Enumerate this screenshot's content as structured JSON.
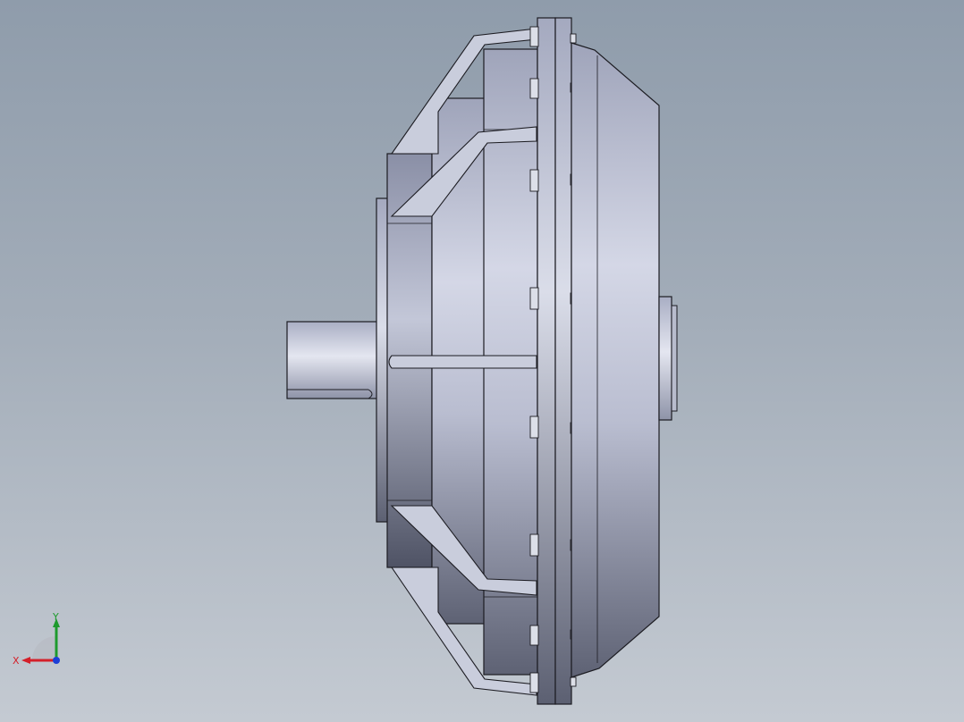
{
  "viewport": {
    "background_top": "#8f9cab",
    "background_bottom": "#c4cad2"
  },
  "model": {
    "component": "hydraulic-coupling",
    "view": "side",
    "body_color": "#b7bcd0",
    "edge_color": "#1c1c22",
    "bolt_color": "#d9dce6"
  },
  "triad": {
    "x_label": "X",
    "y_label": "Y",
    "x_color": "#d4202a",
    "y_color": "#1e9a2e",
    "z_color": "#1c3fd6"
  }
}
